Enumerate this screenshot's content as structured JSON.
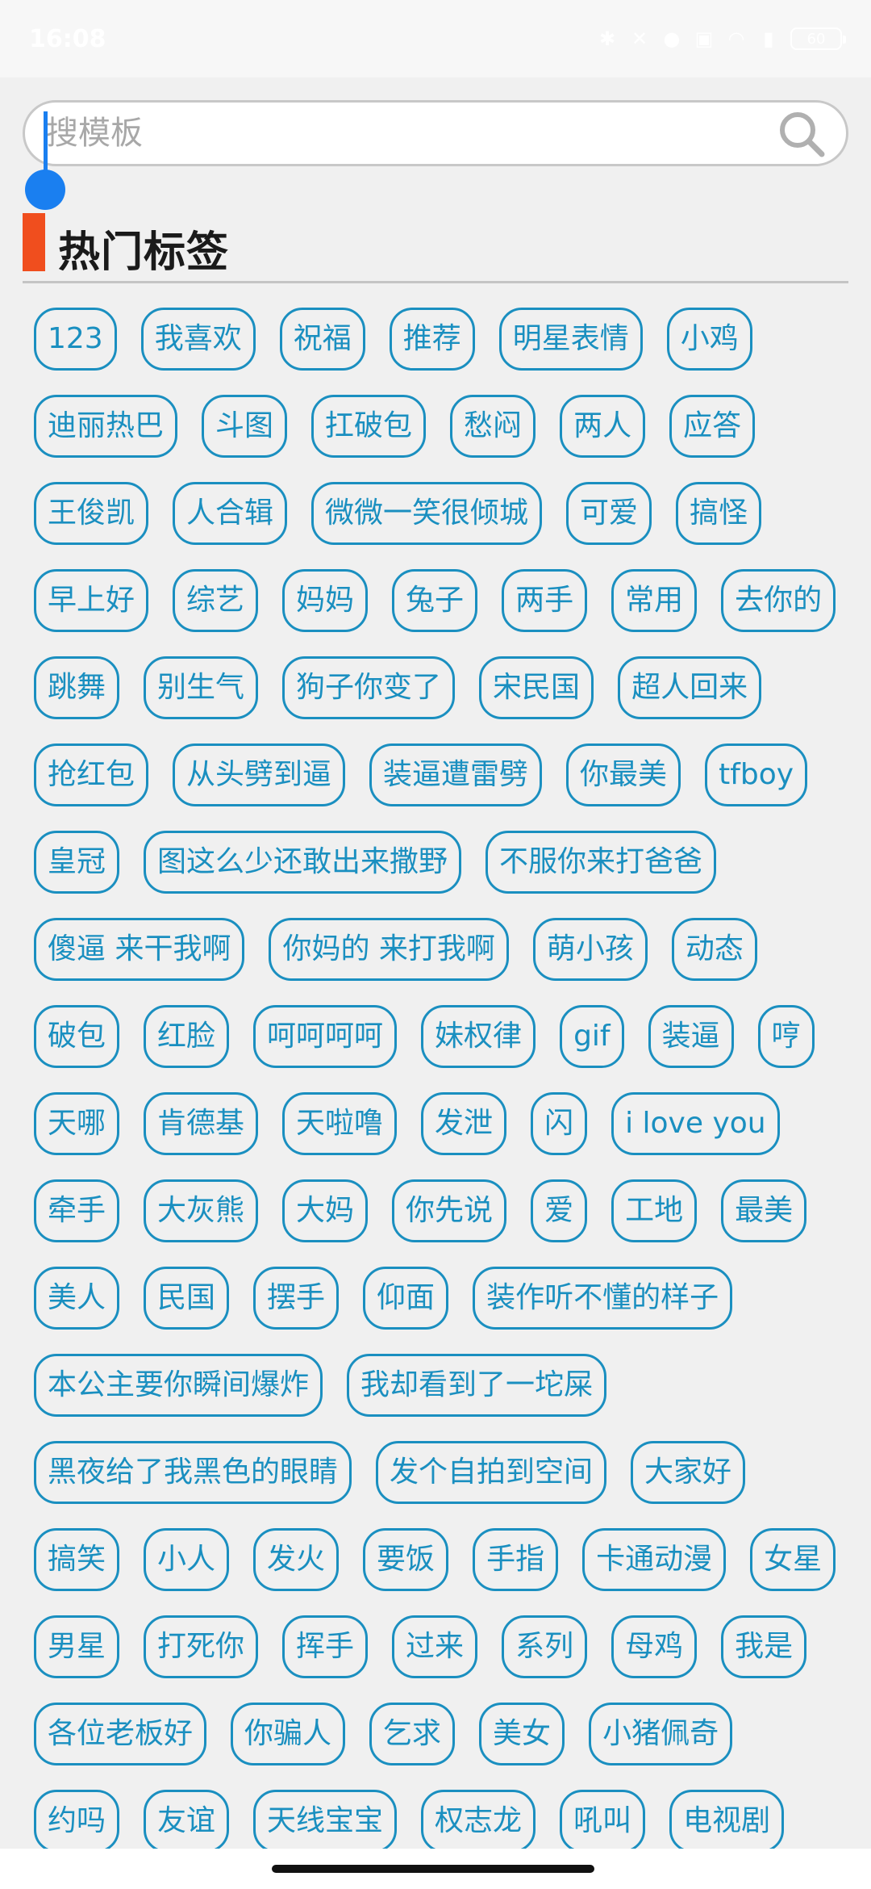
{
  "status_bar": {
    "time": "16:08",
    "battery": "60",
    "icons": [
      "bluetooth-icon",
      "mute-icon",
      "alarm-icon",
      "hd-icon",
      "wifi-icon",
      "signal-icon"
    ]
  },
  "search": {
    "placeholder": "搜模板"
  },
  "section": {
    "title": "热门标签"
  },
  "colors": {
    "tag_accent": "#1a8fc0",
    "section_marker": "#f04e1e",
    "cursor": "#1a7ff0"
  },
  "tag_rows": [
    [
      "123",
      "我喜欢",
      "祝福",
      "推荐",
      "明星表情",
      "小鸡"
    ],
    [
      "迪丽热巴",
      "斗图",
      "扛破包",
      "愁闷",
      "两人",
      "应答"
    ],
    [
      "王俊凯",
      "人合辑",
      "微微一笑很倾城",
      "可爱",
      "搞怪"
    ],
    [
      "早上好",
      "综艺",
      "妈妈",
      "兔子",
      "两手",
      "常用",
      "去你的"
    ],
    [
      "跳舞",
      "别生气",
      "狗子你变了",
      "宋民国",
      "超人回来"
    ],
    [
      "抢红包",
      "从头劈到逼",
      "装逼遭雷劈",
      "你最美",
      "tfboy"
    ],
    [
      "皇冠",
      "图这么少还敢出来撒野",
      "不服你来打爸爸"
    ],
    [
      "傻逼 来干我啊",
      "你妈的 来打我啊",
      "萌小孩",
      "动态"
    ],
    [
      "破包",
      "红脸",
      "呵呵呵呵",
      "妹权律",
      "gif",
      "装逼",
      "哼"
    ],
    [
      "天哪",
      "肯德基",
      "天啦噜",
      "发泄",
      "闪",
      "i love you"
    ],
    [
      "牵手",
      "大灰熊",
      "大妈",
      "你先说",
      "爱",
      "工地",
      "最美"
    ],
    [
      "美人",
      "民国",
      "摆手",
      "仰面",
      "装作听不懂的样子"
    ],
    [
      "本公主要你瞬间爆炸",
      "我却看到了一坨屎"
    ],
    [
      "黑夜给了我黑色的眼睛",
      "发个自拍到空间",
      "大家好"
    ],
    [
      "搞笑",
      "小人",
      "发火",
      "要饭",
      "手指",
      "卡通动漫",
      "女星"
    ],
    [
      "男星",
      "打死你",
      "挥手",
      "过来",
      "系列",
      "母鸡",
      "我是"
    ],
    [
      "各位老板好",
      "你骗人",
      "乞求",
      "美女",
      "小猪佩奇"
    ],
    [
      "约吗",
      "友谊",
      "天线宝宝",
      "权志龙",
      "吼叫",
      "电视剧"
    ]
  ]
}
